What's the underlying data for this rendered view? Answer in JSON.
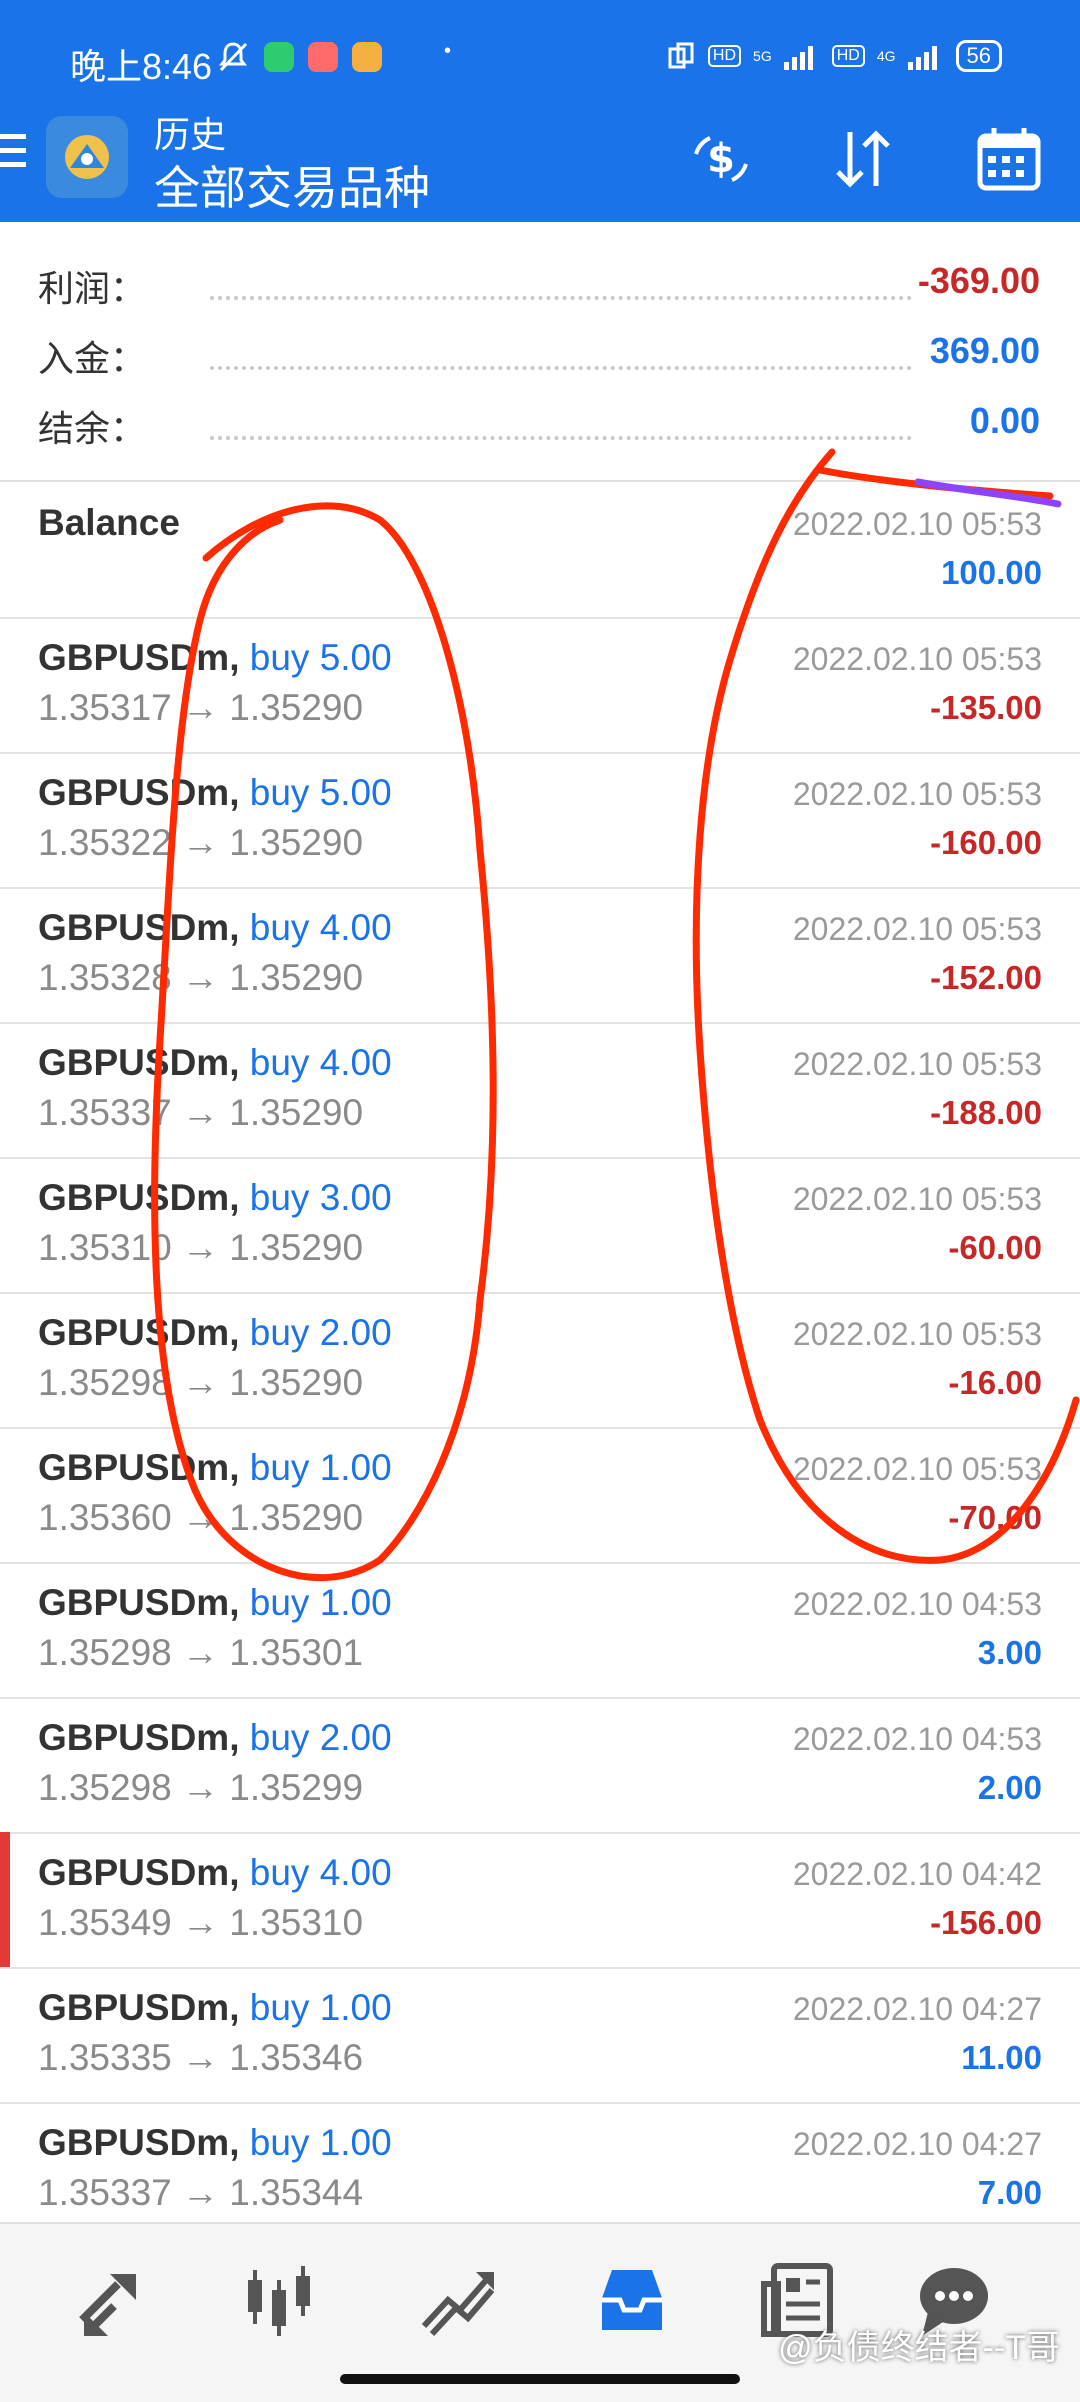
{
  "status_bar": {
    "time": "晚上8:46",
    "dot": "•",
    "signal_left_label": "HD",
    "signal_left_type": "5G",
    "signal_right_label": "HD",
    "signal_right_type": "4G",
    "battery": "56"
  },
  "header": {
    "title_top": "历史",
    "title_main": "全部交易品种"
  },
  "summary": {
    "profit_label": "利润：",
    "profit_value": "-369.00",
    "deposit_label": "入金：",
    "deposit_value": "369.00",
    "balance_label": "结余：",
    "balance_value": "0.00"
  },
  "balance_row": {
    "label": "Balance",
    "date": "2022.02.10 05:53",
    "amount": "100.00"
  },
  "trades": [
    {
      "symbol": "GBPUSDm,",
      "side": "buy 5.00",
      "prices": "1.35317 → 1.35290",
      "date": "2022.02.10 05:53",
      "amount": "-135.00"
    },
    {
      "symbol": "GBPUSDm,",
      "side": "buy 5.00",
      "prices": "1.35322 → 1.35290",
      "date": "2022.02.10 05:53",
      "amount": "-160.00"
    },
    {
      "symbol": "GBPUSDm,",
      "side": "buy 4.00",
      "prices": "1.35328 → 1.35290",
      "date": "2022.02.10 05:53",
      "amount": "-152.00"
    },
    {
      "symbol": "GBPUSDm,",
      "side": "buy 4.00",
      "prices": "1.35337 → 1.35290",
      "date": "2022.02.10 05:53",
      "amount": "-188.00"
    },
    {
      "symbol": "GBPUSDm,",
      "side": "buy 3.00",
      "prices": "1.35310 → 1.35290",
      "date": "2022.02.10 05:53",
      "amount": "-60.00"
    },
    {
      "symbol": "GBPUSDm,",
      "side": "buy 2.00",
      "prices": "1.35298 → 1.35290",
      "date": "2022.02.10 05:53",
      "amount": "-16.00"
    },
    {
      "symbol": "GBPUSDm,",
      "side": "buy 1.00",
      "prices": "1.35360 → 1.35290",
      "date": "2022.02.10 05:53",
      "amount": "-70.00"
    },
    {
      "symbol": "GBPUSDm,",
      "side": "buy 1.00",
      "prices": "1.35298 → 1.35301",
      "date": "2022.02.10 04:53",
      "amount": "3.00"
    },
    {
      "symbol": "GBPUSDm,",
      "side": "buy 2.00",
      "prices": "1.35298 → 1.35299",
      "date": "2022.02.10 04:53",
      "amount": "2.00"
    },
    {
      "symbol": "GBPUSDm,",
      "side": "buy 4.00",
      "prices": "1.35349 → 1.35310",
      "date": "2022.02.10 04:42",
      "amount": "-156.00"
    },
    {
      "symbol": "GBPUSDm,",
      "side": "buy 1.00",
      "prices": "1.35335 → 1.35346",
      "date": "2022.02.10 04:27",
      "amount": "11.00"
    },
    {
      "symbol": "GBPUSDm,",
      "side": "buy 1.00",
      "prices": "1.35337 → 1.35344",
      "date": "2022.02.10 04:27",
      "amount": "7.00"
    }
  ],
  "bottom_nav": {
    "items": [
      "quotes-icon",
      "chart-icon",
      "trade-icon",
      "history-icon",
      "news-icon",
      "chat-icon"
    ],
    "active": "history-icon"
  },
  "watermark": "@负债终结者--T哥",
  "colors": {
    "header": "#1a73e8",
    "positive": "#1a73e8",
    "negative": "#c62828",
    "annotation": "#ff2a00",
    "annotation_highlight": "#8e44ff"
  }
}
